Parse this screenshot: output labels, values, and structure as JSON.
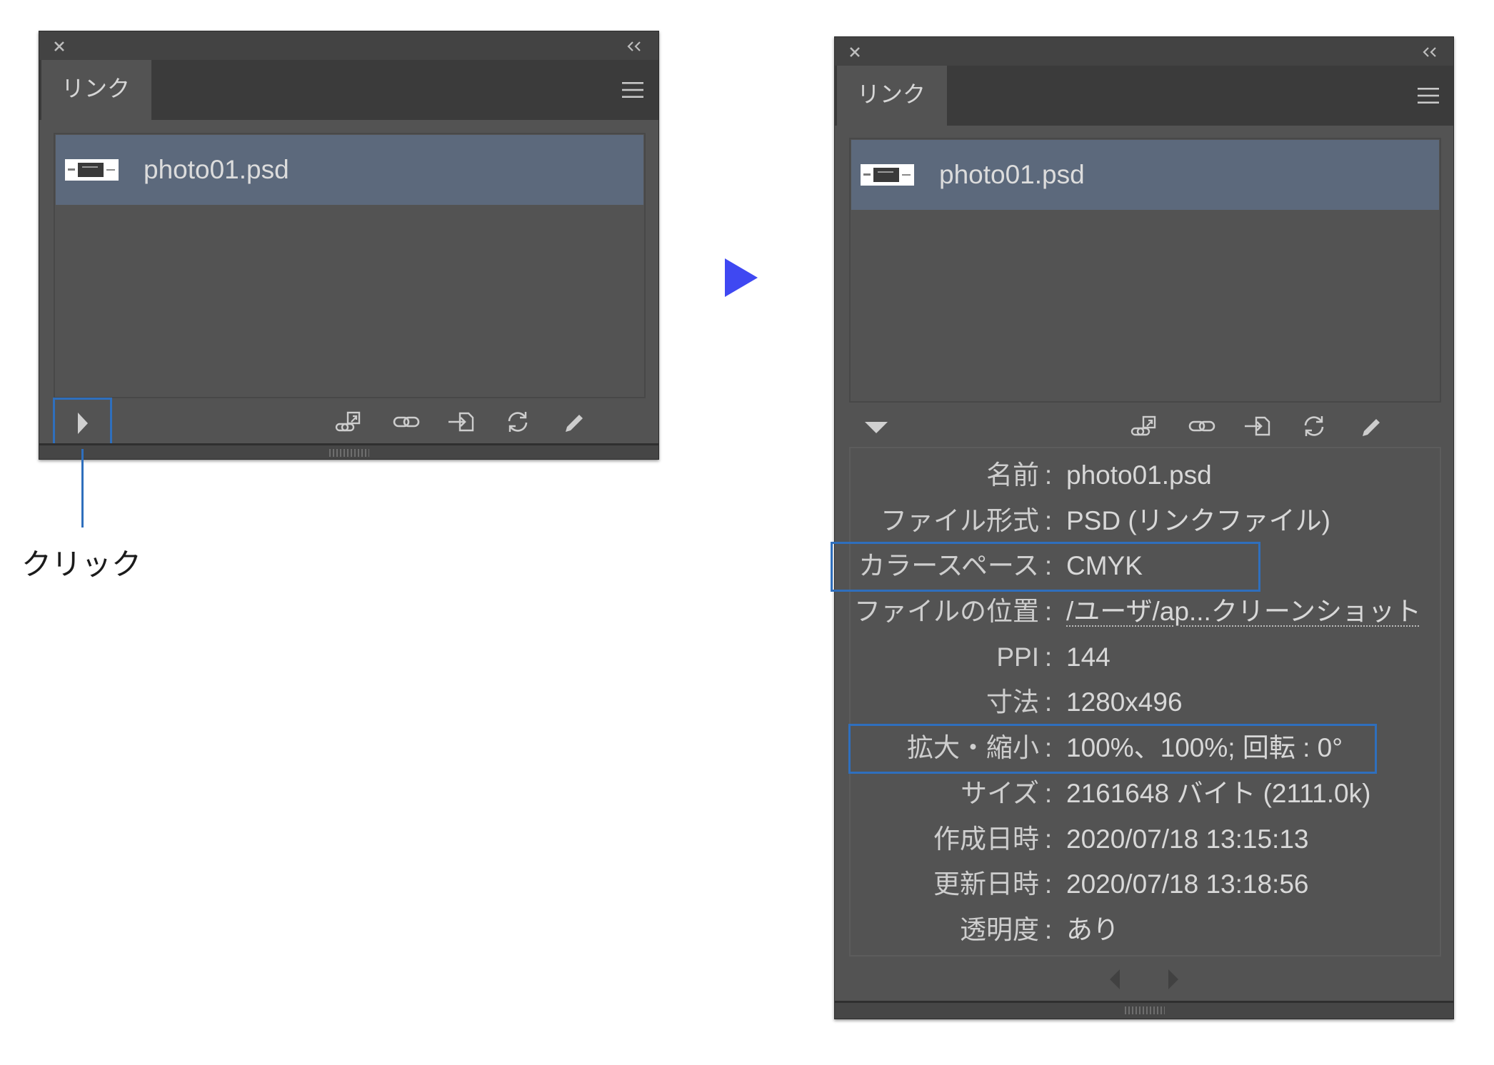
{
  "colors": {
    "panel_bg": "#535353",
    "title_bar": "#434343",
    "tab_row": "#3b3b3b",
    "selection": "#5c697c",
    "highlight": "#2f6fbd",
    "arrow": "#3f48f2",
    "text": "#d6d6d6",
    "icon": "#cdcdcd"
  },
  "left_panel": {
    "close_icon": "close-icon",
    "collapse_icon": "double-chevron-left-icon",
    "tab": {
      "label": "リンク"
    },
    "menu_icon": "hamburger-menu-icon",
    "links": [
      {
        "filename": "photo01.psd",
        "selected": true,
        "thumbnail": "image-thumbnail"
      }
    ],
    "toolbar": {
      "disclosure_icon": "triangle-right-icon",
      "buttons": [
        "relink-cc-libraries-icon",
        "relink-icon",
        "go-to-link-icon",
        "update-link-icon",
        "edit-original-icon"
      ]
    },
    "resize_icon": "resize-grip-icon"
  },
  "annotation": {
    "callout_label": "クリック",
    "arrow_icon": "right-triangle-arrow-icon"
  },
  "right_panel": {
    "close_icon": "close-icon",
    "collapse_icon": "double-chevron-left-icon",
    "tab": {
      "label": "リンク"
    },
    "menu_icon": "hamburger-menu-icon",
    "links": [
      {
        "filename": "photo01.psd",
        "selected": true,
        "thumbnail": "image-thumbnail"
      }
    ],
    "toolbar": {
      "disclosure_icon": "triangle-down-icon",
      "buttons": [
        "relink-cc-libraries-icon",
        "relink-icon",
        "go-to-link-icon",
        "update-link-icon",
        "edit-original-icon"
      ]
    },
    "link_info": {
      "separator": ":",
      "rows": [
        {
          "label": "名前",
          "value": "photo01.psd"
        },
        {
          "label": "ファイル形式",
          "value": "PSD (リンクファイル)"
        },
        {
          "label": "カラースペース",
          "value": "CMYK"
        },
        {
          "label": "ファイルの位置",
          "value": "/ユーザ/ap...クリーンショット"
        },
        {
          "label": "PPI",
          "value": "144"
        },
        {
          "label": "寸法",
          "value": "1280x496"
        },
        {
          "label": "拡大・縮小",
          "value": "100%、100%; 回転 : 0°"
        },
        {
          "label": "サイズ",
          "value": "2161648 バイト (2111.0k)"
        },
        {
          "label": "作成日時",
          "value": "2020/07/18 13:15:13"
        },
        {
          "label": "更新日時",
          "value": "2020/07/18 13:18:56"
        },
        {
          "label": "透明度",
          "value": "あり"
        }
      ]
    },
    "nav": {
      "previous_icon": "triangle-left-icon",
      "next_icon": "triangle-right-icon"
    },
    "resize_icon": "resize-grip-icon"
  }
}
